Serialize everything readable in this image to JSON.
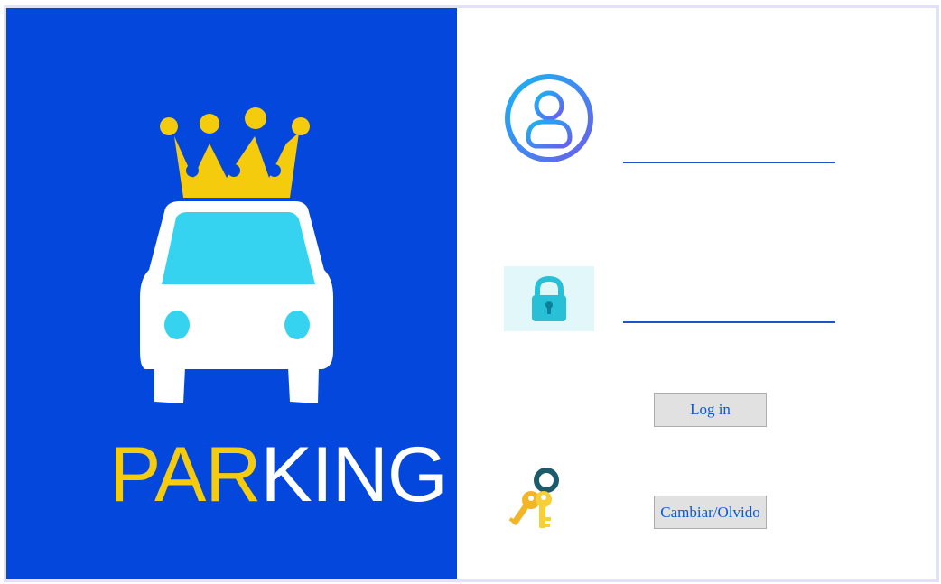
{
  "brand": {
    "part1": "PAR",
    "part2": "KING"
  },
  "icons": {
    "logo": "parking-crown-car-logo",
    "user": "user-icon",
    "lock": "lock-icon",
    "keys": "keys-icon"
  },
  "form": {
    "username_value": "",
    "password_value": "",
    "login_label": "Log in",
    "change_label": "Cambiar/Olvido"
  },
  "colors": {
    "panel_blue": "#0447dd",
    "crown_yellow": "#f5cb0d",
    "car_window": "#35d3f0",
    "input_line": "#1a56c8",
    "button_text": "#0a58d6"
  }
}
